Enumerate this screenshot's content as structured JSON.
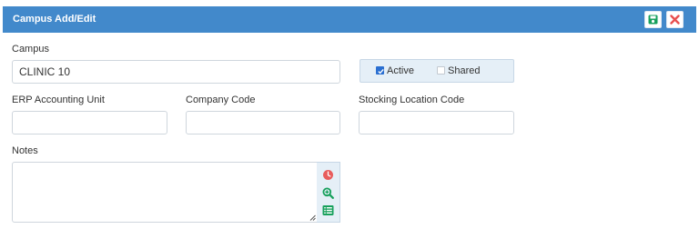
{
  "header": {
    "title": "Campus Add/Edit",
    "save_icon": "save-icon",
    "close_icon": "close-icon",
    "background_color": "#4289cb",
    "save_color": "#17a05c",
    "close_color": "#e85050"
  },
  "form": {
    "campus": {
      "label": "Campus",
      "value": "CLINIC 10"
    },
    "active": {
      "label": "Active",
      "checked": true
    },
    "shared": {
      "label": "Shared",
      "checked": false
    },
    "erp_accounting_unit": {
      "label": "ERP Accounting Unit",
      "value": ""
    },
    "company_code": {
      "label": "Company Code",
      "value": ""
    },
    "stocking_location_code": {
      "label": "Stocking Location Code",
      "value": ""
    },
    "notes": {
      "label": "Notes",
      "value": ""
    }
  },
  "notes_tools": [
    {
      "icon": "clock-icon",
      "color": "#e85c5c"
    },
    {
      "icon": "zoom-in-icon",
      "color": "#17a05c"
    },
    {
      "icon": "list-icon",
      "color": "#17a05c"
    }
  ]
}
